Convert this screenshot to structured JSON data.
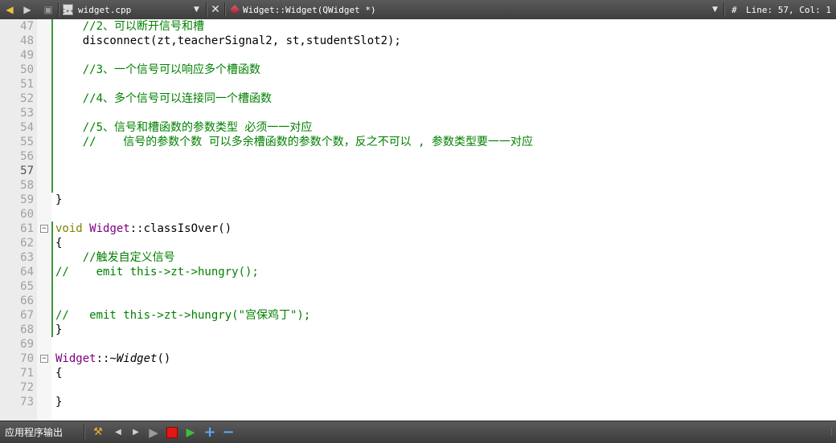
{
  "toolbar": {
    "file_name": "widget.cpp",
    "file_icon_text": "C++",
    "symbol": "Widget::Widget(QWidget *)",
    "hash": "#",
    "position": "Line: 57, Col: 1"
  },
  "editor": {
    "current_line": 57,
    "lines": [
      {
        "n": "47",
        "fold": "",
        "code": [
          {
            "t": "    //2、可以断开信号和槽",
            "c": "cm"
          }
        ]
      },
      {
        "n": "48",
        "fold": "",
        "code": [
          {
            "t": "    disconnect(zt,teacherSignal2, st,studentSlot2);",
            "c": ""
          }
        ]
      },
      {
        "n": "49",
        "fold": "",
        "code": []
      },
      {
        "n": "50",
        "fold": "",
        "code": [
          {
            "t": "    //3、一个信号可以响应多个槽函数",
            "c": "cm"
          }
        ]
      },
      {
        "n": "51",
        "fold": "",
        "code": []
      },
      {
        "n": "52",
        "fold": "",
        "code": [
          {
            "t": "    //4、多个信号可以连接同一个槽函数",
            "c": "cm"
          }
        ]
      },
      {
        "n": "53",
        "fold": "",
        "code": []
      },
      {
        "n": "54",
        "fold": "",
        "code": [
          {
            "t": "    //5、信号和槽函数的参数类型 必须一一对应",
            "c": "cm"
          }
        ]
      },
      {
        "n": "55",
        "fold": "",
        "code": [
          {
            "t": "    //    信号的参数个数 可以多余槽函数的参数个数，反之不可以 , 参数类型要一一对应",
            "c": "cm"
          }
        ]
      },
      {
        "n": "56",
        "fold": "",
        "code": []
      },
      {
        "n": "57",
        "fold": "",
        "code": []
      },
      {
        "n": "58",
        "fold": "",
        "code": []
      },
      {
        "n": "59",
        "fold": "",
        "code": [
          {
            "t": "}",
            "c": ""
          }
        ]
      },
      {
        "n": "60",
        "fold": "",
        "code": []
      },
      {
        "n": "61",
        "fold": "−",
        "code": [
          {
            "t": "void",
            "c": "kw"
          },
          {
            "t": " ",
            "c": ""
          },
          {
            "t": "Widget",
            "c": "ty"
          },
          {
            "t": "::classIsOver()",
            "c": ""
          }
        ]
      },
      {
        "n": "62",
        "fold": "",
        "code": [
          {
            "t": "{",
            "c": ""
          }
        ]
      },
      {
        "n": "63",
        "fold": "",
        "code": [
          {
            "t": "    //触发自定义信号",
            "c": "cm"
          }
        ]
      },
      {
        "n": "64",
        "fold": "",
        "code": [
          {
            "t": "//    emit this->zt->hungry();",
            "c": "cm"
          }
        ]
      },
      {
        "n": "65",
        "fold": "",
        "code": []
      },
      {
        "n": "66",
        "fold": "",
        "code": []
      },
      {
        "n": "67",
        "fold": "",
        "code": [
          {
            "t": "//   emit this->zt->hungry(\"宫保鸡丁\");",
            "c": "cm"
          }
        ]
      },
      {
        "n": "68",
        "fold": "",
        "code": [
          {
            "t": "}",
            "c": ""
          }
        ]
      },
      {
        "n": "69",
        "fold": "",
        "code": []
      },
      {
        "n": "70",
        "fold": "−",
        "code": [
          {
            "t": "Widget",
            "c": "ty"
          },
          {
            "t": "::~",
            "c": ""
          },
          {
            "t": "Widget",
            "c": "it"
          },
          {
            "t": "()",
            "c": ""
          }
        ]
      },
      {
        "n": "71",
        "fold": "",
        "code": [
          {
            "t": "{",
            "c": ""
          }
        ]
      },
      {
        "n": "72",
        "fold": "",
        "code": []
      },
      {
        "n": "73",
        "fold": "",
        "code": [
          {
            "t": "}",
            "c": ""
          }
        ]
      }
    ]
  },
  "output_panel": {
    "label": "应用程序输出"
  }
}
